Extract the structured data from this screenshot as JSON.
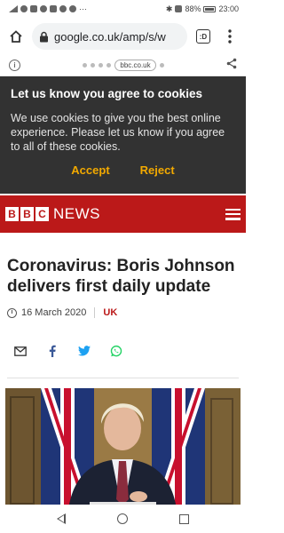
{
  "status_bar": {
    "left_extra": "···",
    "battery_percent": "88%",
    "time": "23:00"
  },
  "browser": {
    "url": "google.co.uk/amp/s/w",
    "tab_count": ":D",
    "domain_chip": "bbc.co.uk"
  },
  "cookie_banner": {
    "title": "Let us know you agree to cookies",
    "body": "We use cookies to give you the best online experience. Please let us know if you agree to all of these cookies.",
    "accept_label": "Accept",
    "reject_label": "Reject",
    "accent_color": "#f2a900"
  },
  "site_header": {
    "logo_letters": [
      "B",
      "B",
      "C"
    ],
    "section": "NEWS",
    "brand_color": "#bb1919"
  },
  "article": {
    "headline": "Coronavirus: Boris Johnson delivers first daily update",
    "date": "16 March 2020",
    "topic": "UK",
    "share_icons": [
      "email-icon",
      "facebook-icon",
      "twitter-icon",
      "whatsapp-icon"
    ]
  }
}
